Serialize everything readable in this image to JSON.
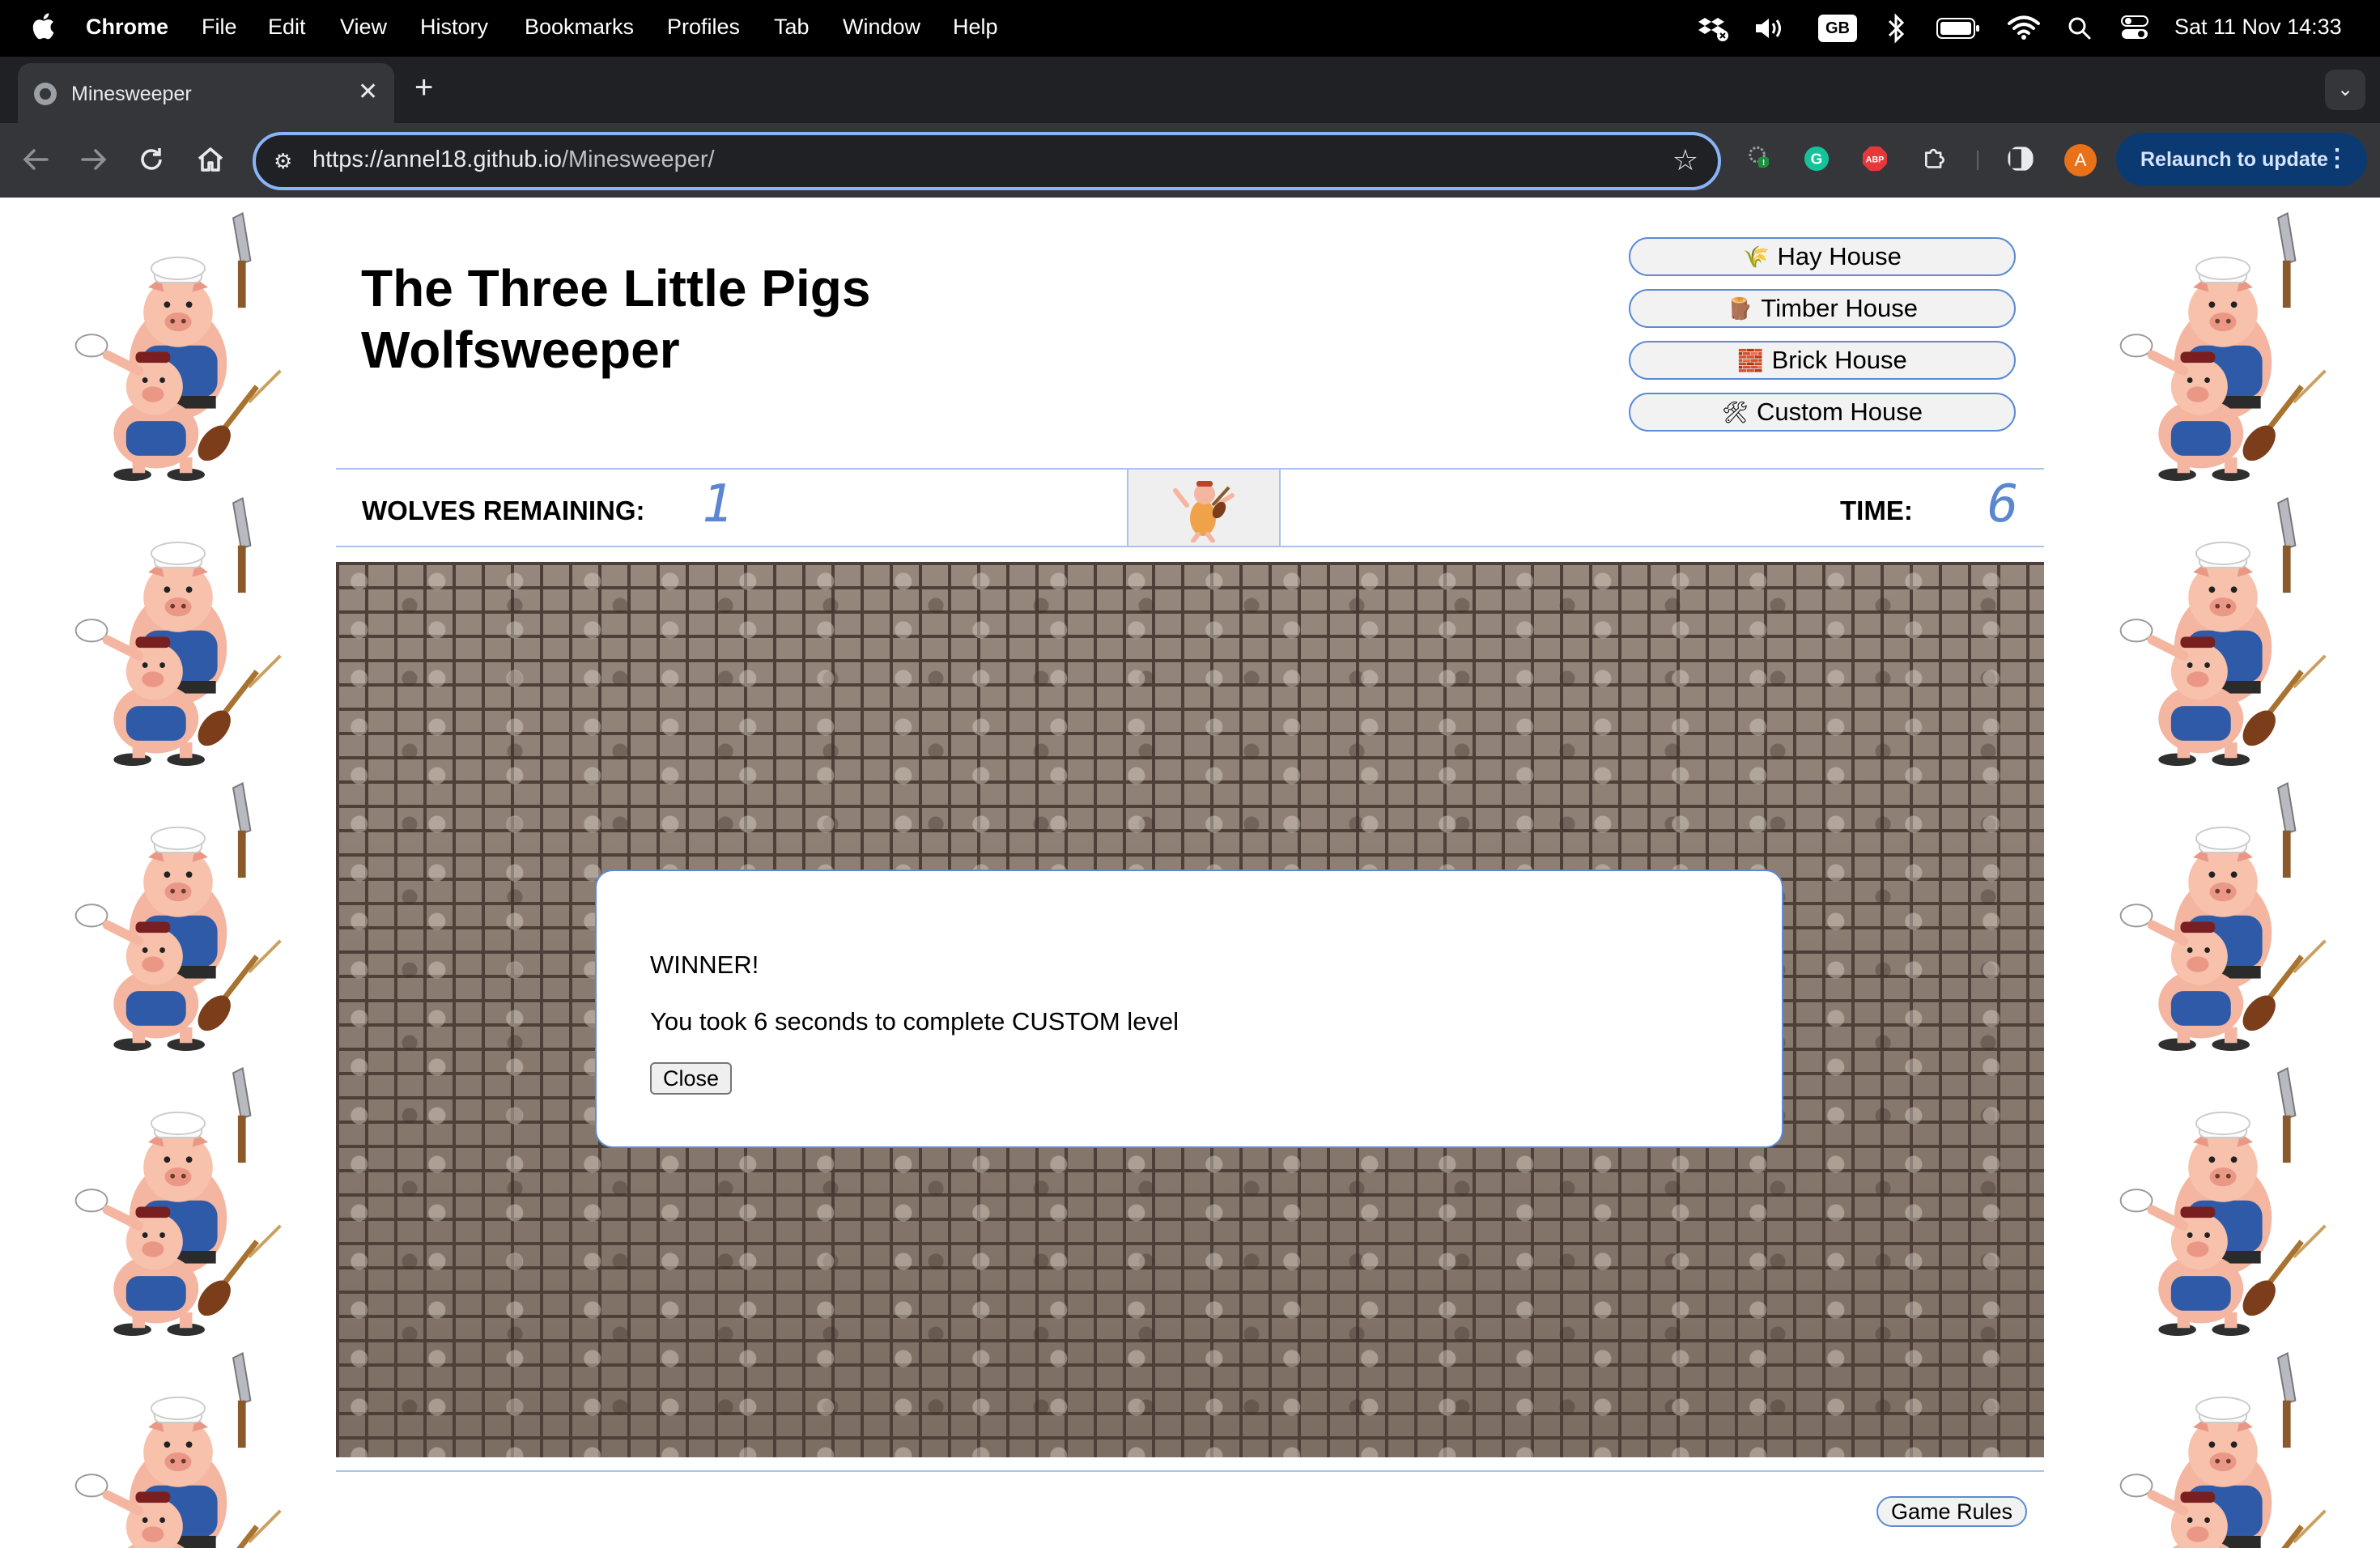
{
  "menubar": {
    "app": "Chrome",
    "items": [
      "File",
      "Edit",
      "View",
      "History",
      "Bookmarks",
      "Profiles",
      "Tab",
      "Window",
      "Help"
    ],
    "input_source": "GB",
    "datetime": "Sat 11 Nov  14:33"
  },
  "browser": {
    "tab_title": "Minesweeper",
    "url_host": "https://annel18.github.io",
    "url_path": "/Minesweeper/",
    "profile_initial": "A",
    "abp_label": "ABP",
    "relaunch_label": "Relaunch to update"
  },
  "page": {
    "title_line1": "The Three Little Pigs",
    "title_line2": "Wolfsweeper",
    "levels": [
      {
        "icon": "hay-icon",
        "glyph": "🌾",
        "label": "Hay House"
      },
      {
        "icon": "wood-log-icon",
        "glyph": "🪵",
        "label": "Timber House"
      },
      {
        "icon": "brick-icon",
        "glyph": "🧱",
        "label": "Brick House"
      },
      {
        "icon": "tools-icon",
        "glyph": "🛠",
        "label": "Custom House"
      }
    ],
    "status": {
      "wolves_label": "WOLVES REMAINING:",
      "wolves_value": "1",
      "time_label": "TIME:",
      "time_value": "6"
    },
    "modal": {
      "heading": "WINNER!",
      "message": "You took 6 seconds to complete CUSTOM level",
      "close_label": "Close"
    },
    "rules_label": "Game Rules"
  },
  "colors": {
    "accent_blue": "#5b8bd6",
    "digit_blue": "#5b86d0",
    "chrome_dark": "#202124",
    "chrome_toolbar": "#35363a",
    "relaunch_bg": "#0b3a73"
  }
}
